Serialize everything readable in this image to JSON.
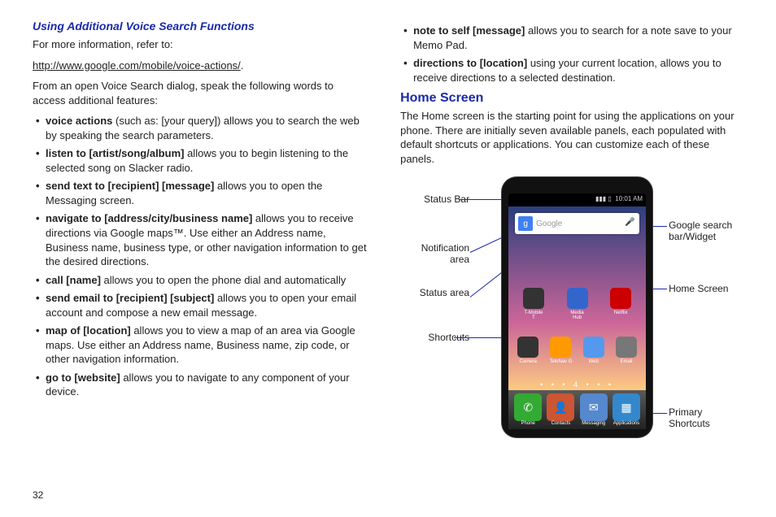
{
  "page_number": "32",
  "left": {
    "subhead": "Using Additional Voice Search Functions",
    "intro1": "For more information, refer to:",
    "link_text": "http://www.google.com/mobile/voice-actions/",
    "intro2": "From an open Voice Search dialog, speak the following words to access additional features:",
    "bullets": [
      {
        "b": "voice actions",
        "t": " (such as: [your query]) allows you to search the web by speaking the search parameters."
      },
      {
        "b": "listen to [artist/song/album]",
        "t": " allows you to begin listening to the selected song on Slacker radio."
      },
      {
        "b": "send text to [recipient] [message]",
        "t": " allows you to open the Messaging screen."
      },
      {
        "b": "navigate to [address/city/business name]",
        "t": " allows you to receive directions via Google maps™. Use either an Address name, Business name, business type, or other navigation information to get the desired directions."
      },
      {
        "b": "call [name]",
        "t": " allows you to open the phone dial and automatically"
      },
      {
        "b": "send email to [recipient] [subject]",
        "t": " allows you to open your email account and compose a new email message."
      },
      {
        "b": "map of [location]",
        "t": " allows you to view a map of an area via Google maps. Use either an Address name, Business name, zip code, or other navigation information."
      },
      {
        "b": "go to [website]",
        "t": " allows you to navigate to any component of your device."
      }
    ]
  },
  "right": {
    "top_bullets": [
      {
        "b": "note to self [message]",
        "t": " allows you to search for a note save to your Memo Pad."
      },
      {
        "b": "directions to [location]",
        "t": " using your current location, allows you to receive directions to a selected destination."
      }
    ],
    "sect": "Home Screen",
    "sect_para": "The Home screen is the starting point for using the applications on your phone. There are initially seven available panels, each populated with default shortcuts or applications. You can customize each of these panels.",
    "labels": {
      "status_bar": "Status Bar",
      "notification_area": "Notification area",
      "status_area": "Status area",
      "shortcuts": "Shortcuts",
      "google_search": "Google search bar/Widget",
      "home_screen": "Home Screen",
      "primary_shortcuts": "Primary Shortcuts"
    },
    "phone": {
      "time": "10:01 AM",
      "signal": "▮▮▮ ▯",
      "search_placeholder": "Google",
      "row1": [
        {
          "name": "T-Mobile T",
          "color": "#333"
        },
        {
          "name": "Media Hub",
          "color": "#3366cc"
        },
        {
          "name": "Netflix",
          "color": "#cc0000"
        }
      ],
      "row2": [
        {
          "name": "Camera",
          "color": "#333"
        },
        {
          "name": "TeleNav G",
          "color": "#ff9900"
        },
        {
          "name": "Web",
          "color": "#5599ee"
        },
        {
          "name": "Email",
          "color": "#777"
        }
      ],
      "dots": "• • • 4 • • •",
      "dock": [
        {
          "name": "Phone",
          "color": "#33aa33",
          "glyph": "✆"
        },
        {
          "name": "Contacts",
          "color": "#cc5533",
          "glyph": "👤"
        },
        {
          "name": "Messaging",
          "color": "#5588cc",
          "glyph": "✉"
        },
        {
          "name": "Applications",
          "color": "#3388cc",
          "glyph": "▦"
        }
      ]
    }
  }
}
